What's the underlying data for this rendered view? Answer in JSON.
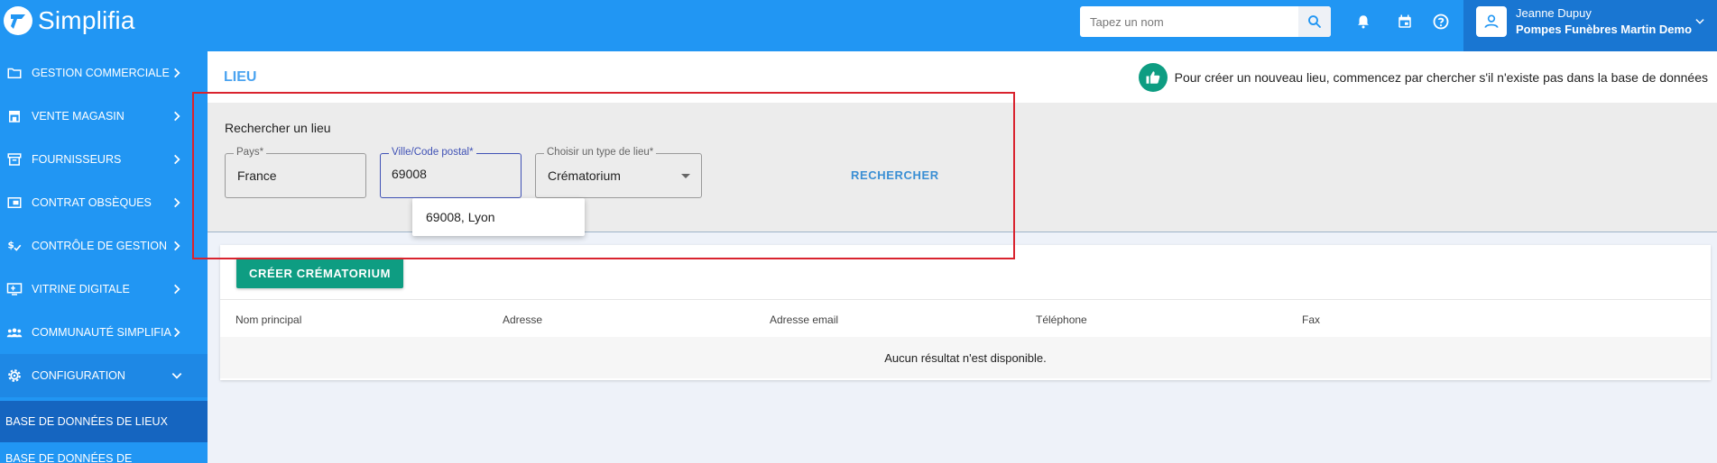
{
  "app": {
    "name": "Simplifia"
  },
  "topbar": {
    "search_placeholder": "Tapez un nom",
    "user": {
      "name": "Jeanne Dupuy",
      "company": "Pompes Funèbres Martin Demo"
    }
  },
  "sidebar": {
    "items": [
      {
        "label": "Gestion commerciale",
        "icon": "folder-icon"
      },
      {
        "label": "Vente magasin",
        "icon": "store-icon"
      },
      {
        "label": "Fournisseurs",
        "icon": "archive-box-icon"
      },
      {
        "label": "Contrat obsèques",
        "icon": "contract-icon"
      },
      {
        "label": "Contrôle de gestion",
        "icon": "money-check-icon"
      },
      {
        "label": "Vitrine digitale",
        "icon": "monitor-icon"
      },
      {
        "label": "Communauté Simplifia",
        "icon": "community-icon"
      },
      {
        "label": "Configuration",
        "icon": "gear-icon"
      }
    ],
    "sub_items": [
      {
        "label": "Base de données de lieux"
      },
      {
        "label": "Base de données de"
      }
    ]
  },
  "page": {
    "title": "Lieu",
    "tip": "Pour créer un nouveau lieu, commencez par chercher s'il n'existe pas dans la base de données"
  },
  "search_form": {
    "title": "Rechercher un lieu",
    "country": {
      "label": "Pays*",
      "value": "France"
    },
    "city": {
      "label": "Ville/Code postal*",
      "value": "69008"
    },
    "place_type": {
      "label": "Choisir un type de lieu*",
      "value": "Crématorium"
    },
    "submit_label": "Rechercher",
    "suggestion": "69008, Lyon"
  },
  "results": {
    "create_label": "Créer crématorium",
    "columns": [
      "Nom principal",
      "Adresse",
      "Adresse email",
      "Téléphone",
      "Fax"
    ],
    "empty_message": "Aucun résultat n'est disponible."
  },
  "colors": {
    "primary": "#2196f3",
    "primary_dark": "#1976d2",
    "accent_green": "#0e9d82",
    "highlight_red": "#d9232e"
  }
}
